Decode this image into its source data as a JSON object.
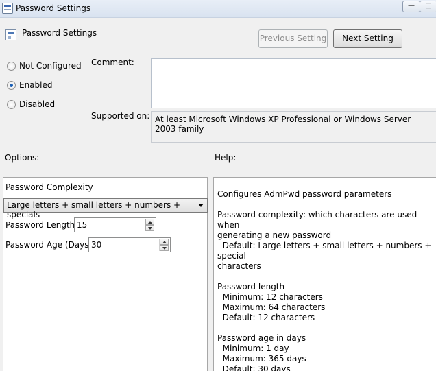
{
  "window": {
    "title": "Password Settings",
    "minimize_glyph": "—",
    "maximize_glyph": "□"
  },
  "header": {
    "title": "Password Settings",
    "previous_label": "Previous Setting",
    "next_label": "Next Setting"
  },
  "state": {
    "options": [
      {
        "label": "Not Configured",
        "checked": false
      },
      {
        "label": "Enabled",
        "checked": true
      },
      {
        "label": "Disabled",
        "checked": false
      }
    ]
  },
  "comment": {
    "label": "Comment:",
    "value": ""
  },
  "supported": {
    "label": "Supported on:",
    "value": "At least Microsoft Windows XP Professional or Windows Server 2003 family"
  },
  "options_panel": {
    "label": "Options:",
    "complexity_label": "Password Complexity",
    "complexity_value": "Large letters + small letters + numbers + specials",
    "length_label": "Password Length",
    "length_value": "15",
    "age_label": "Password Age (Days)",
    "age_value": "30"
  },
  "help_panel": {
    "label": "Help:",
    "text": "Configures AdmPwd password parameters\n\nPassword complexity: which characters are used when\ngenerating a new password\n  Default: Large letters + small letters + numbers + special\ncharacters\n\nPassword length\n  Minimum: 12 characters\n  Maximum: 64 characters\n  Default: 12 characters\n\nPassword age in days\n  Minimum: 1 day\n  Maximum: 365 days\n  Default: 30 days"
  },
  "icons": {
    "window": "policy-window-icon",
    "policy": "policy-settings-icon",
    "dropdown": "chevron-down-icon",
    "spin_up": "spin-up-icon",
    "spin_down": "spin-down-icon"
  }
}
